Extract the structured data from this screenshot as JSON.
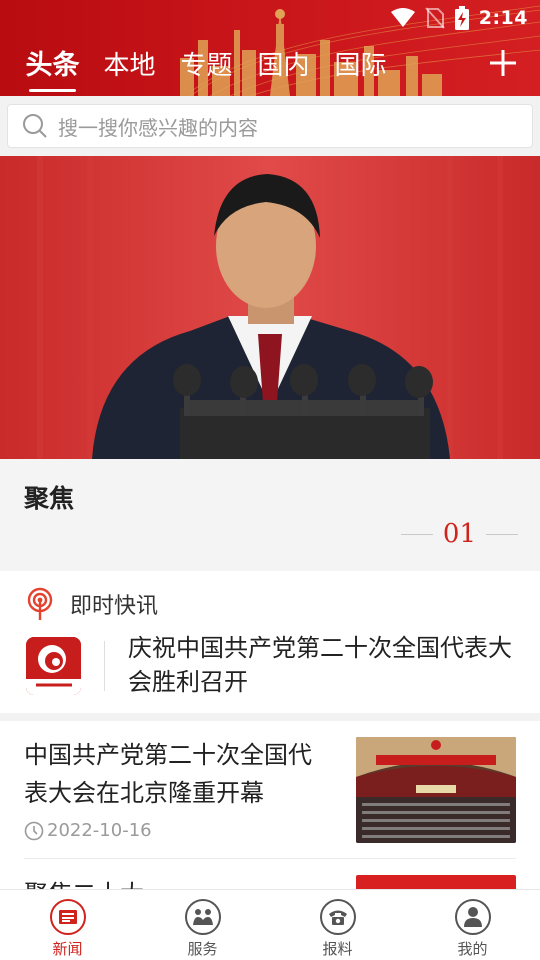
{
  "status_bar": {
    "time": "2:14"
  },
  "tabs": [
    {
      "label": "头条",
      "active": true
    },
    {
      "label": "本地",
      "active": false
    },
    {
      "label": "专题",
      "active": false
    },
    {
      "label": "国内",
      "active": false
    },
    {
      "label": "国际",
      "active": false
    }
  ],
  "search": {
    "placeholder": "搜一搜你感兴趣的内容"
  },
  "focus": {
    "title": "聚焦",
    "page": "01"
  },
  "flash": {
    "title": "即时快讯",
    "text": "庆祝中国共产党第二十次全国代表大会胜利召开"
  },
  "news": [
    {
      "title": "中国共产党第二十次全国代表大会在北京隆重开幕",
      "date": "2022-10-16"
    },
    {
      "title": "聚焦二十大"
    }
  ],
  "bottom_nav": [
    {
      "label": "新闻",
      "icon": "newspaper-icon",
      "active": true
    },
    {
      "label": "服务",
      "icon": "handshake-icon",
      "active": false
    },
    {
      "label": "报料",
      "icon": "phone-icon",
      "active": false
    },
    {
      "label": "我的",
      "icon": "user-icon",
      "active": false
    }
  ],
  "colors": {
    "brand_red": "#c8151a",
    "accent_red": "#d0231d"
  }
}
